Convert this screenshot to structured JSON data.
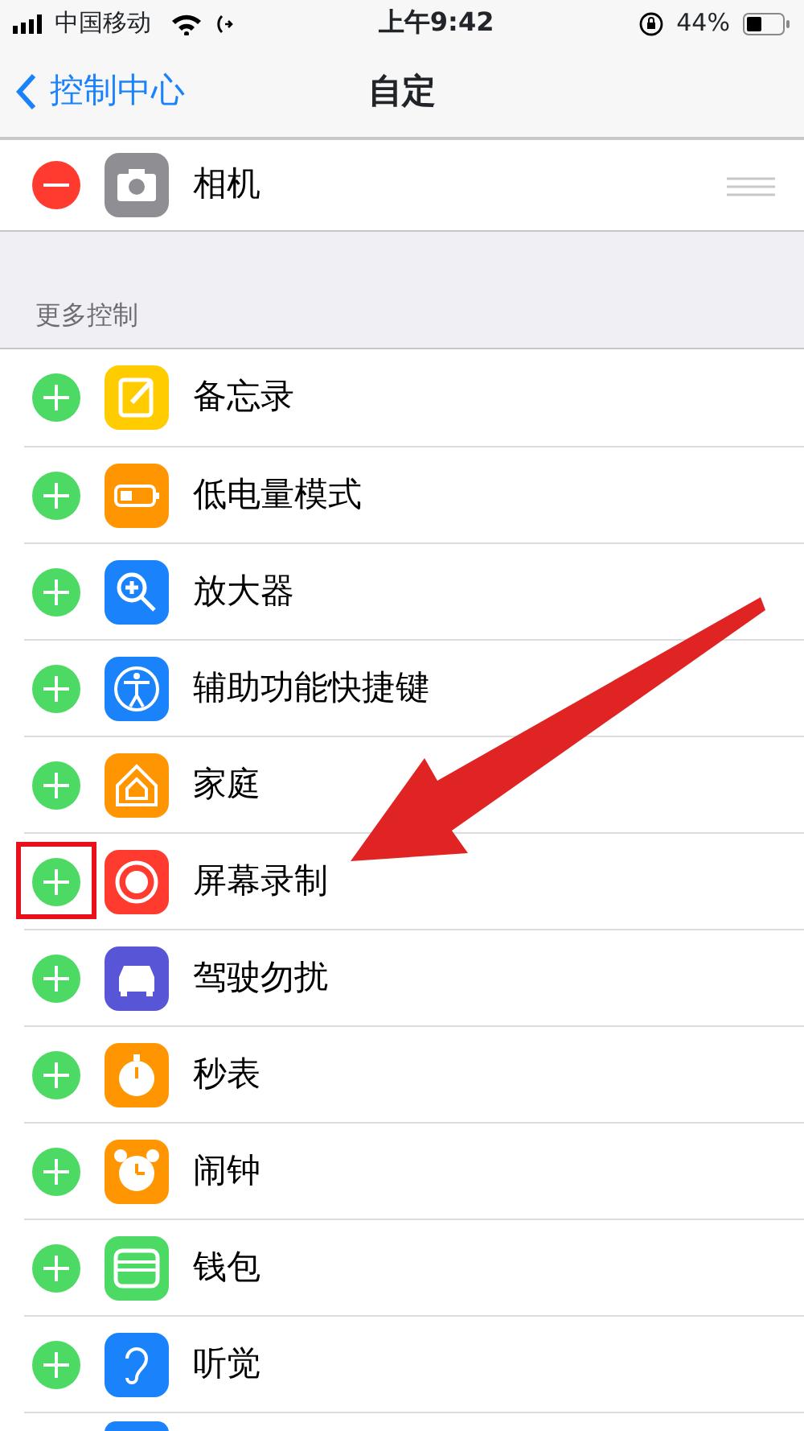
{
  "status_bar": {
    "carrier": "中国移动",
    "time": "上午9:42",
    "battery": "44%"
  },
  "nav": {
    "back": "控制中心",
    "title": "自定"
  },
  "included": [
    {
      "label": "相机",
      "color": "#8e8e93"
    }
  ],
  "more_header": "更多控制",
  "more": [
    {
      "label": "备忘录",
      "color": "#ffcc00",
      "highlighted": false
    },
    {
      "label": "低电量模式",
      "color": "#ff9500",
      "highlighted": false
    },
    {
      "label": "放大器",
      "color": "#1a82fb",
      "highlighted": false
    },
    {
      "label": "辅助功能快捷键",
      "color": "#1a82fb",
      "highlighted": false
    },
    {
      "label": "家庭",
      "color": "#ff9500",
      "highlighted": false
    },
    {
      "label": "屏幕录制",
      "color": "#ff3b30",
      "highlighted": true
    },
    {
      "label": "驾驶勿扰",
      "color": "#5856d6",
      "highlighted": false
    },
    {
      "label": "秒表",
      "color": "#ff9500",
      "highlighted": false
    },
    {
      "label": "闹钟",
      "color": "#ff9500",
      "highlighted": false
    },
    {
      "label": "钱包",
      "color": "#4cd964",
      "highlighted": false
    },
    {
      "label": "听觉",
      "color": "#1a82fb",
      "highlighted": false
    },
    {
      "color": "#1a82fb"
    }
  ],
  "annotation": {
    "arrow": true
  }
}
